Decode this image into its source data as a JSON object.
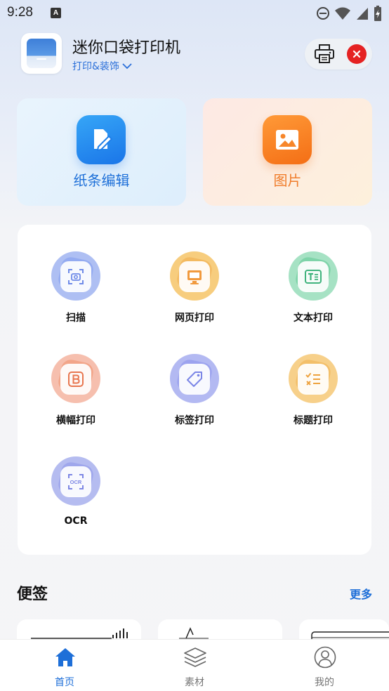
{
  "status_bar": {
    "time": "9:28",
    "notif_letter": "A",
    "icons": [
      "do-not-disturb-icon",
      "wifi-icon",
      "signal-icon",
      "battery-icon"
    ]
  },
  "header": {
    "title": "迷你口袋打印机",
    "subtitle": "打印&装饰",
    "icons": [
      "app-logo",
      "printer-icon",
      "close-icon",
      "chevron-down-icon"
    ],
    "close_color": "#e52222"
  },
  "cards": [
    {
      "label": "纸条编辑",
      "icon": "edit-document-icon",
      "color": "#1d6fd8"
    },
    {
      "label": "图片",
      "icon": "image-icon",
      "color": "#f07c2a"
    }
  ],
  "tools": [
    {
      "label": "扫描",
      "icon": "scan-camera-icon"
    },
    {
      "label": "网页打印",
      "icon": "monitor-icon"
    },
    {
      "label": "文本打印",
      "icon": "text-icon"
    },
    {
      "label": "横幅打印",
      "icon": "banner-b-icon"
    },
    {
      "label": "标签打印",
      "icon": "tag-icon"
    },
    {
      "label": "标题打印",
      "icon": "checklist-icon"
    },
    {
      "label": "OCR",
      "icon": "ocr-icon"
    }
  ],
  "notes": {
    "title": "便签",
    "more": "更多"
  },
  "tabbar": {
    "active_color": "#1e6fd8",
    "tabs": [
      {
        "label": "首页",
        "icon": "home-icon",
        "active": true
      },
      {
        "label": "素材",
        "icon": "layers-icon",
        "active": false
      },
      {
        "label": "我的",
        "icon": "profile-icon",
        "active": false
      }
    ]
  }
}
